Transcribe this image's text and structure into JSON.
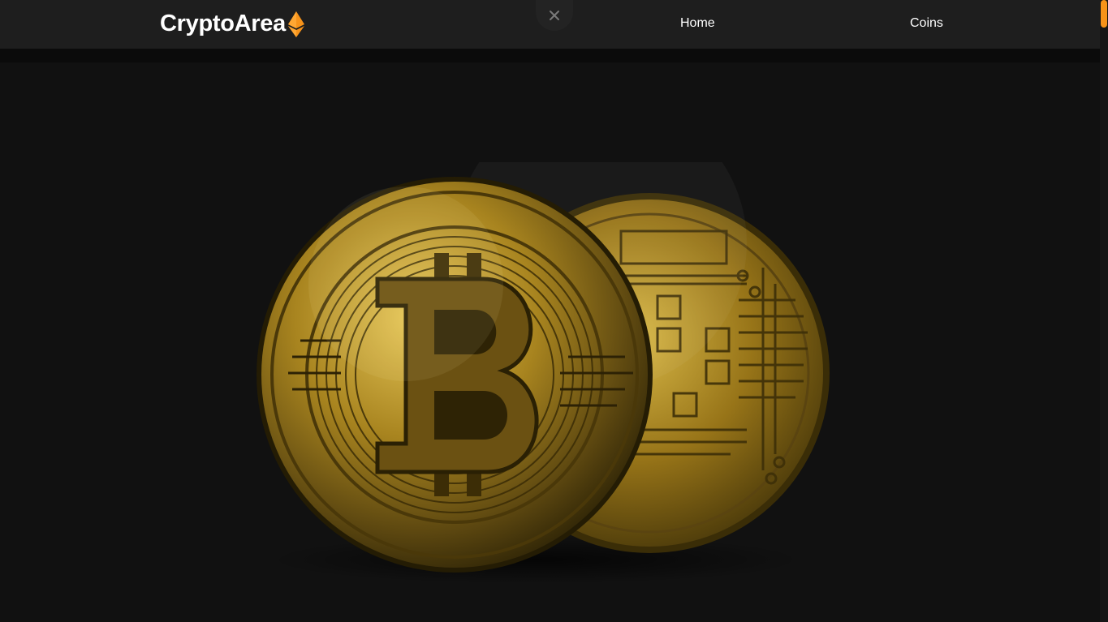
{
  "brand": {
    "name": "CryptoArea",
    "accent": "#f7931a"
  },
  "nav": {
    "links": [
      {
        "label": "Home"
      },
      {
        "label": "Coins"
      }
    ]
  },
  "icons": {
    "logo": "ethereum-diamond-icon",
    "close": "close-icon"
  },
  "hero": {
    "image": "bitcoin-coins"
  },
  "colors": {
    "navbar": "#1e1e1e",
    "background": "#111111",
    "gold": "#c9a227"
  }
}
